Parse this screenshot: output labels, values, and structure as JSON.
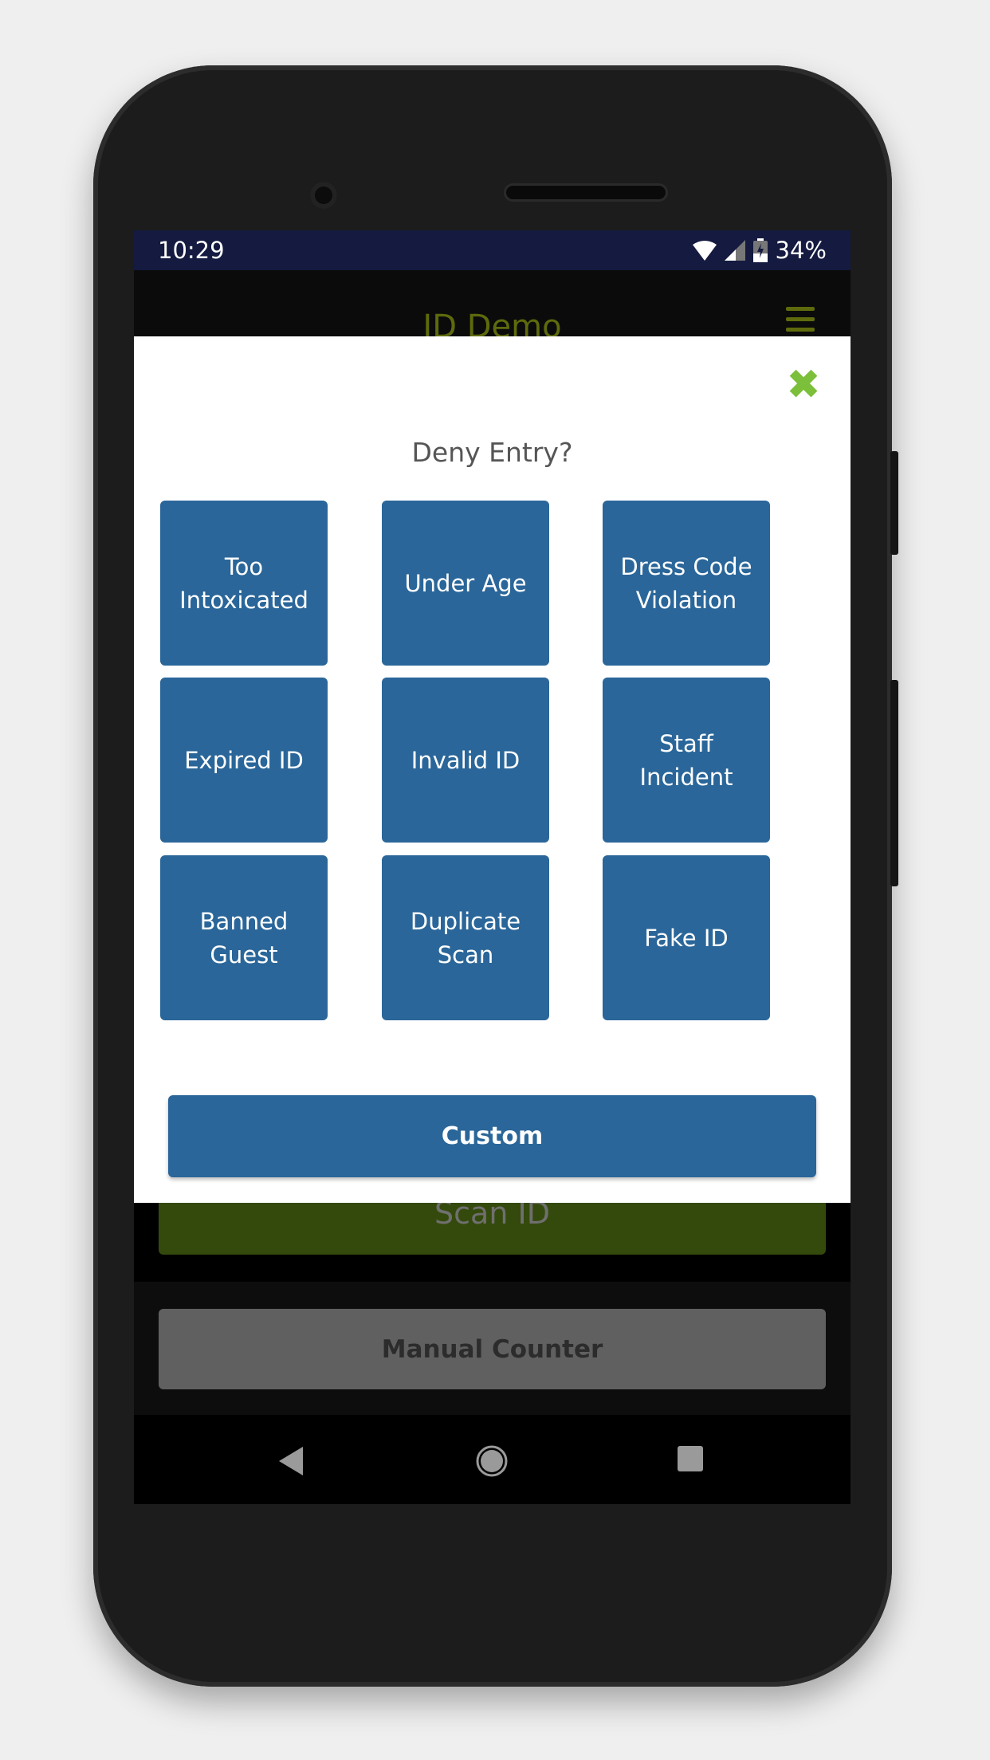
{
  "status_bar": {
    "time": "10:29",
    "battery": "34%"
  },
  "app": {
    "title": "ID Demo",
    "menu_icon": "hamburger-icon"
  },
  "modal": {
    "title": "Deny Entry?",
    "close_icon": "close-x-icon",
    "close_color": "#7cbf3a",
    "reasons": [
      "Too Intoxicated",
      "Under Age",
      "Dress Code Violation",
      "Expired ID",
      "Invalid ID",
      "Staff Incident",
      "Banned Guest",
      "Duplicate Scan",
      "Fake ID"
    ],
    "custom_label": "Custom",
    "button_color": "#2a6699"
  },
  "background": {
    "scan_label": "Scan ID",
    "manual_label": "Manual Counter"
  },
  "colors": {
    "status_bar": "#141a40",
    "brand": "#5e6a0c"
  }
}
